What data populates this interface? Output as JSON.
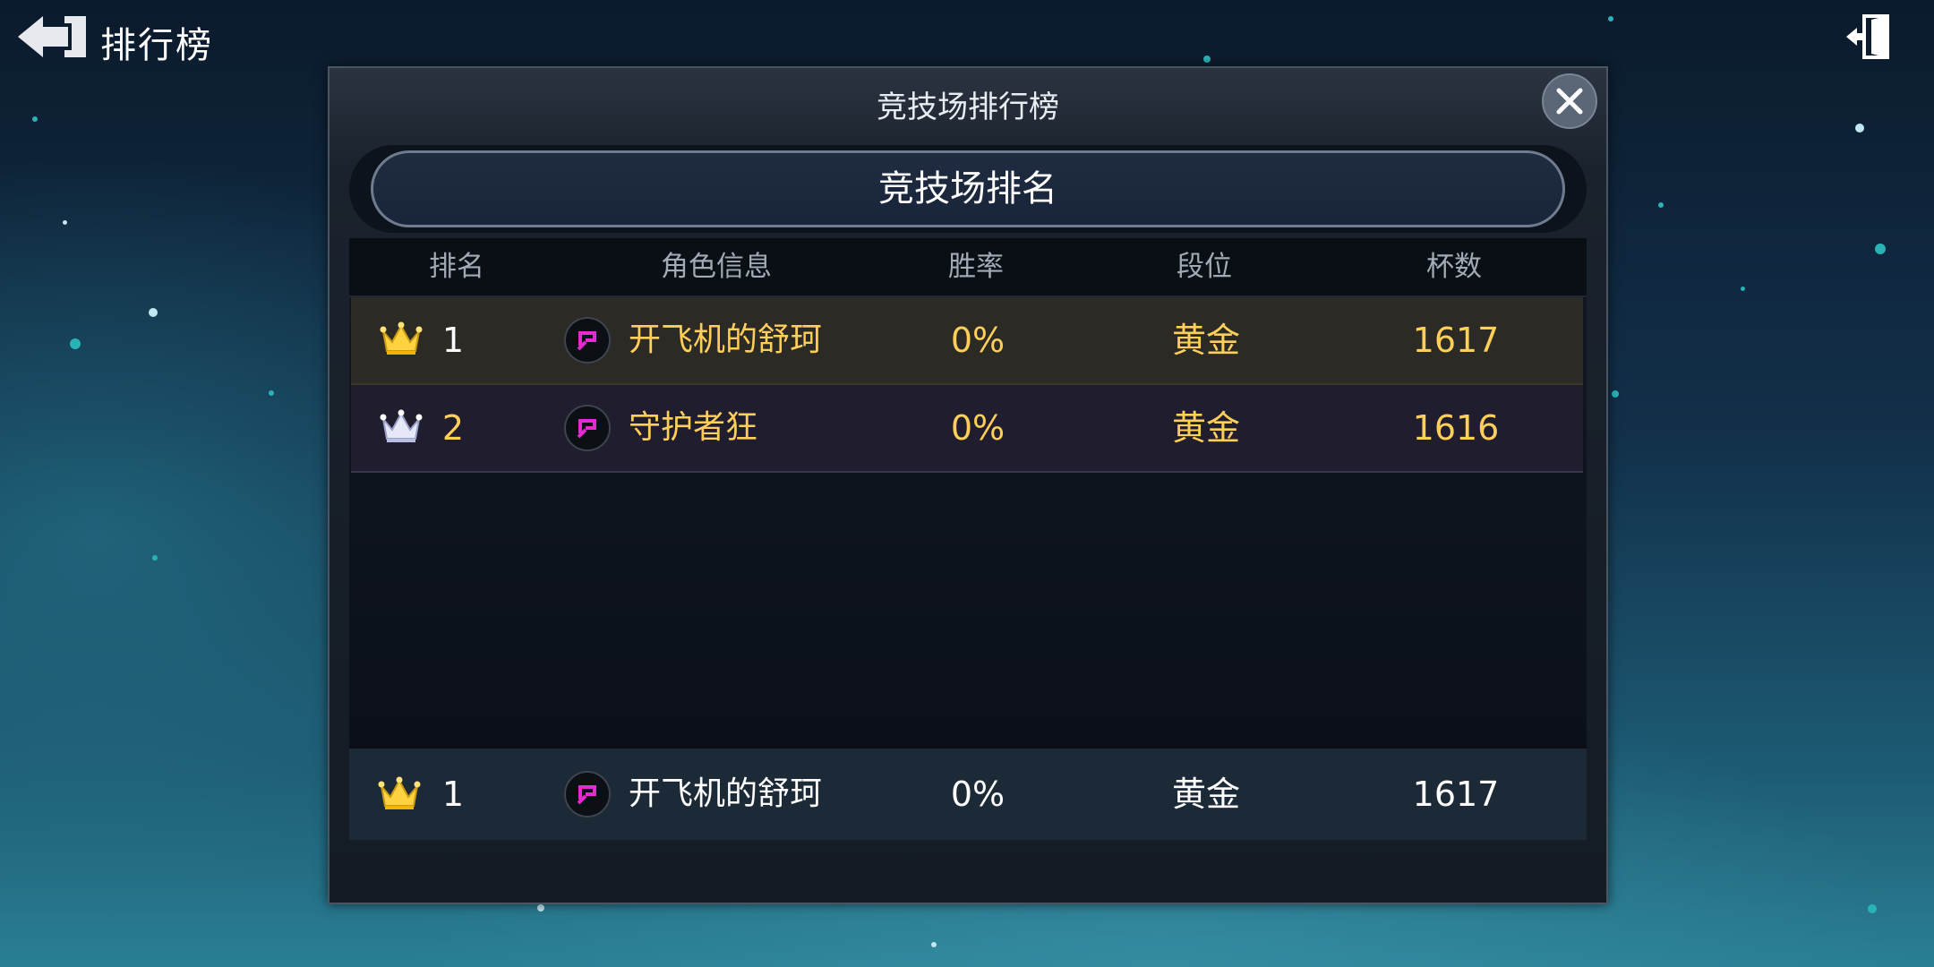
{
  "header": {
    "title": "排行榜"
  },
  "panel": {
    "title": "竞技场排行榜",
    "tab_label": "竞技场排名"
  },
  "table": {
    "columns": [
      "排名",
      "角色信息",
      "胜率",
      "段位",
      "杯数"
    ],
    "rows": [
      {
        "rank": "1",
        "crown": "gold-crown-icon",
        "name": "开飞机的舒珂",
        "win_rate": "0%",
        "tier": "黄金",
        "cups": "1617"
      },
      {
        "rank": "2",
        "crown": "silver-crown-icon",
        "name": "守护者狂",
        "win_rate": "0%",
        "tier": "黄金",
        "cups": "1616"
      }
    ]
  },
  "my_entry": {
    "rank": "1",
    "crown": "gold-crown-icon",
    "name": "开飞机的舒珂",
    "win_rate": "0%",
    "tier": "黄金",
    "cups": "1617"
  },
  "colors": {
    "accent_gold": "#ffcf5a",
    "first_row_bg": "#2c2a25",
    "second_row_bg": "#201d2e",
    "avatar_icon": "#e62ad2"
  }
}
